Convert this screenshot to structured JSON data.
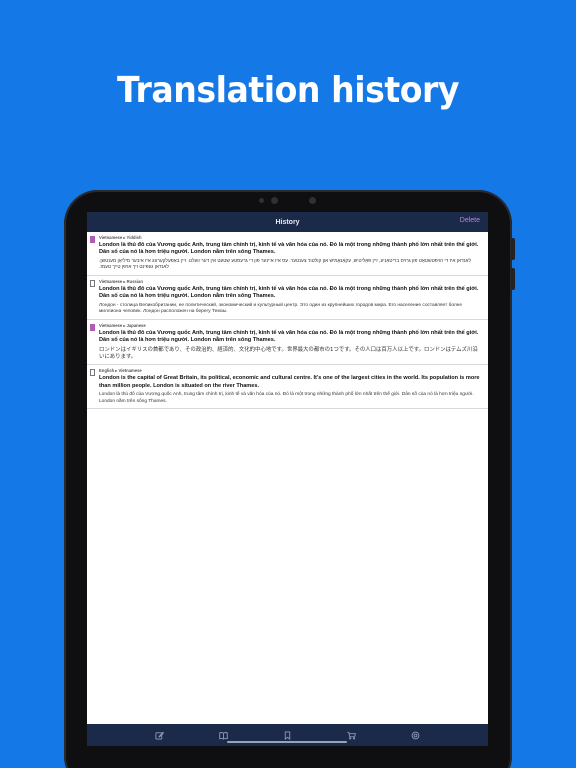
{
  "promo": {
    "title": "Translation history"
  },
  "nav": {
    "title": "History",
    "delete_label": "Delete"
  },
  "colors": {
    "background": "#1478e6",
    "bar": "#1c2a4a",
    "accent": "#b784e0",
    "bookmark": "#b05cb0"
  },
  "entries": [
    {
      "bookmarked": true,
      "languages": "Vietnamese ▸ Yiddish",
      "source": "London là thủ đô của Vương quốc Anh, trung tâm chính trị, kinh tế và văn hóa của nó. Đó là một trong những thành phố lớn nhất trên thế giới. Dân số của nó là hơn triệu người. London nằm trên sông Thames.",
      "translation": "לאנדאן איז די הויפּטשטאָט פון גרויס בריטאַניע, זיין פּאָליטיש, עקאָנאָמיש און קולטור צענטער. עס איז איינער פון די גרעסטע שטעט אין דער וועלט. זיין באַפעלקערונג איז איבער מיליאָן מענטשן. לאנדאן געפינט זיך אויפן טייך טעמז."
    },
    {
      "bookmarked": false,
      "languages": "Vietnamese ▸ Russian",
      "source": "London là thủ đô của Vương quốc Anh, trung tâm chính trị, kinh tế và văn hóa của nó. Đó là một trong những thành phố lớn nhất trên thế giới. Dân số của nó là hơn triệu người. London nằm trên sông Thames.",
      "translation": "Лондон - столица Великобритании, ее политический, экономический и культурный центр. Это один из крупнейших городов мира. Его население составляет более миллиона человек. Лондон расположен на берегу Темзы."
    },
    {
      "bookmarked": true,
      "languages": "Vietnamese ▸ Japanese",
      "source": "London là thủ đô của Vương quốc Anh, trung tâm chính trị, kinh tế và văn hóa của nó. Đó là một trong những thành phố lớn nhất trên thế giới. Dân số của nó là hơn triệu người. London nằm trên sông Thames.",
      "translation": "ロンドンはイギリスの首都であり、その政治的、経済的、文化的中心地です。世界最大の都市の1つです。その人口は百万人以上です。ロンドンはテムズ川沿いにあります。"
    },
    {
      "bookmarked": false,
      "languages": "English ▸ Vietnamese",
      "source": "London is the capital of Great Britain, its political, economic and cultural centre. It's one of the largest cities in the world. Its population is more than million people. London is situated on the river Thames.",
      "translation": "London là thủ đô của Vương quốc Anh, trung tâm chính trị, kinh tế và văn hóa của nó. Đó là một trong những thành phố lớn nhất trên thế giới. Dân số của nó là hơn triệu người. London nằm trên sông Thames."
    }
  ],
  "tabs": [
    {
      "name": "translate",
      "icon": "edit-icon"
    },
    {
      "name": "dictionary",
      "icon": "book-icon"
    },
    {
      "name": "bookmarks",
      "icon": "bookmark-icon"
    },
    {
      "name": "store",
      "icon": "cart-icon"
    },
    {
      "name": "settings",
      "icon": "gear-icon"
    }
  ]
}
